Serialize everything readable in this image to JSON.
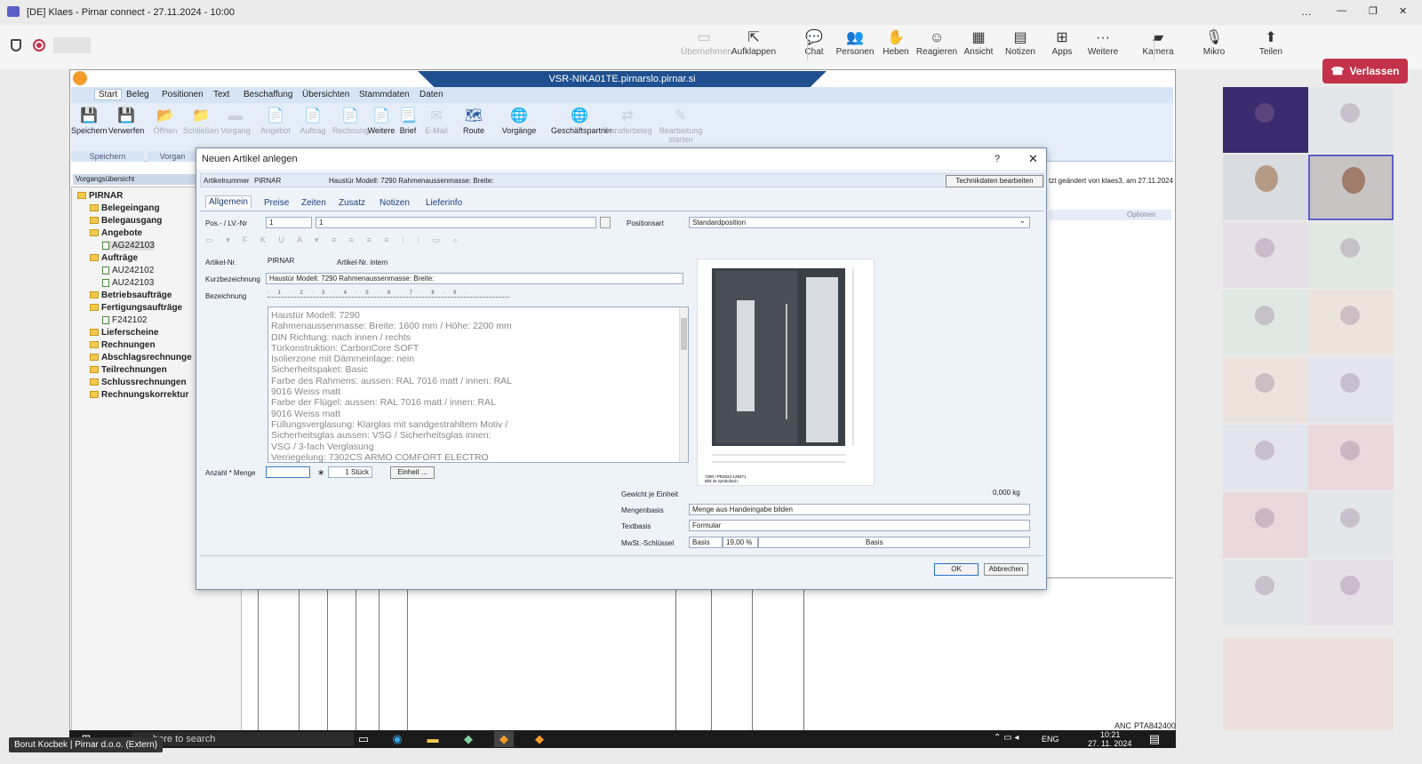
{
  "window": {
    "title": "[DE] Klaes - Pirnar connect - 27.11.2024 - 10:00",
    "controls": [
      "…",
      "—",
      "❐",
      "✕"
    ]
  },
  "meeting_toolbar": {
    "items": [
      {
        "label": "Übernehmen",
        "icon": "take-control-icon",
        "glyph": "▭",
        "disabled": true
      },
      {
        "label": "Aufklappen",
        "icon": "pop-out-icon",
        "glyph": "⇱",
        "disabled": false
      },
      {
        "label": "Chat",
        "icon": "chat-icon",
        "glyph": "💬",
        "disabled": false
      },
      {
        "label": "Personen",
        "icon": "people-icon",
        "glyph": "👥",
        "disabled": false
      },
      {
        "label": "Heben",
        "icon": "raise-hand-icon",
        "glyph": "✋",
        "disabled": false
      },
      {
        "label": "Reagieren",
        "icon": "react-icon",
        "glyph": "☺",
        "disabled": false
      },
      {
        "label": "Ansicht",
        "icon": "view-icon",
        "glyph": "▦",
        "disabled": false
      },
      {
        "label": "Notizen",
        "icon": "notes-icon",
        "glyph": "▤",
        "disabled": false
      },
      {
        "label": "Apps",
        "icon": "apps-icon",
        "glyph": "⊞",
        "disabled": false
      },
      {
        "label": "Weitere",
        "icon": "more-icon",
        "glyph": "···",
        "disabled": false
      },
      {
        "label": "Kamera",
        "icon": "camera-off-icon",
        "glyph": "▰",
        "disabled": false
      },
      {
        "label": "Mikro",
        "icon": "mic-off-icon",
        "glyph": "🎙",
        "disabled": false
      },
      {
        "label": "Teilen",
        "icon": "share-icon",
        "glyph": "⬆",
        "disabled": false
      }
    ],
    "leave_label": "Verlassen"
  },
  "remote": {
    "session_title": "VSR-NIKA01TE.pirnarslo.pirnar.si",
    "ribbon_tabs": [
      "Start",
      "Beleg",
      "Positionen",
      "Text",
      "Beschaffung",
      "Übersichten",
      "Stammdaten",
      "Daten"
    ],
    "ribbon_buttons": [
      {
        "label": "Speichern",
        "icon": "save-icon",
        "glyph": "💾",
        "disabled": false
      },
      {
        "label": "Verwerfen",
        "icon": "discard-icon",
        "glyph": "💾",
        "disabled": false
      },
      {
        "label": "Öffnen",
        "icon": "open-folder-icon",
        "glyph": "📂",
        "disabled": true
      },
      {
        "label": "Schließen",
        "icon": "close-folder-icon",
        "glyph": "📁",
        "disabled": true
      },
      {
        "label": "Vorgang",
        "icon": "process-icon",
        "glyph": "▬",
        "disabled": true
      },
      {
        "label": "Angebot",
        "icon": "offer-icon",
        "glyph": "📄",
        "disabled": true
      },
      {
        "label": "Auftrag",
        "icon": "order-icon",
        "glyph": "📄",
        "disabled": true
      },
      {
        "label": "Rechnung",
        "icon": "invoice-icon",
        "glyph": "📄",
        "disabled": true
      },
      {
        "label": "Weitere",
        "icon": "more-docs-icon",
        "glyph": "📄",
        "disabled": false
      },
      {
        "label": "Brief",
        "icon": "letter-icon",
        "glyph": "📃",
        "disabled": false
      },
      {
        "label": "E-Mail",
        "icon": "email-icon",
        "glyph": "✉",
        "disabled": true
      },
      {
        "label": "Route",
        "icon": "route-icon",
        "glyph": "🗺",
        "disabled": false
      },
      {
        "label": "Vorgänge",
        "icon": "processes-icon",
        "glyph": "🌐",
        "disabled": false
      },
      {
        "label": "Geschäftspartner",
        "icon": "partner-icon",
        "glyph": "🌐",
        "disabled": false
      },
      {
        "label": "Transferbeleg",
        "icon": "transfer-icon",
        "glyph": "⇄",
        "disabled": true
      },
      {
        "label": "Bearbeitung starten",
        "icon": "start-edit-icon",
        "glyph": "✎",
        "disabled": true
      }
    ],
    "ribbon_groups": [
      "Speichern",
      "Vorgan"
    ],
    "left_pane_title": "Vorgangsübersicht",
    "tree": [
      {
        "label": "PIRNAR",
        "level": 0,
        "kind": "folder",
        "bold": true
      },
      {
        "label": "Belegeingang",
        "level": 1,
        "kind": "folder",
        "bold": true
      },
      {
        "label": "Belegausgang",
        "level": 1,
        "kind": "folder",
        "bold": true
      },
      {
        "label": "Angebote",
        "level": 1,
        "kind": "folder",
        "bold": true
      },
      {
        "label": "AG242103",
        "level": 2,
        "kind": "doc",
        "bold": false
      },
      {
        "label": "Aufträge",
        "level": 1,
        "kind": "folder",
        "bold": true
      },
      {
        "label": "AU242102",
        "level": 2,
        "kind": "doc",
        "bold": false
      },
      {
        "label": "AU242103",
        "level": 2,
        "kind": "doc",
        "bold": false
      },
      {
        "label": "Betriebsaufträge",
        "level": 1,
        "kind": "folder",
        "bold": true
      },
      {
        "label": "Fertigungsaufträge",
        "level": 1,
        "kind": "folder",
        "bold": true
      },
      {
        "label": "F242102",
        "level": 2,
        "kind": "doc",
        "bold": false
      },
      {
        "label": "Lieferscheine",
        "level": 1,
        "kind": "folder",
        "bold": true
      },
      {
        "label": "Rechnungen",
        "level": 1,
        "kind": "folder",
        "bold": true
      },
      {
        "label": "Abschlagsrechnunge",
        "level": 1,
        "kind": "folder",
        "bold": true
      },
      {
        "label": "Teilrechnungen",
        "level": 1,
        "kind": "folder",
        "bold": true
      },
      {
        "label": "Schlussrechnungen",
        "level": 1,
        "kind": "folder",
        "bold": true
      },
      {
        "label": "Rechnungskorrektur",
        "level": 1,
        "kind": "folder",
        "bold": true
      }
    ],
    "last_changed": "tzt geändert von klaes3, am 27.11.2024",
    "options_label": "Optionen",
    "status_right": "PTA842400",
    "status_lang": "ANC"
  },
  "dialog": {
    "title": "Neuen Artikel anlegen",
    "help": "?",
    "close": "✕",
    "header": {
      "artikelnummer_label": "Artikelnummer",
      "artikelnummer_value": "PIRNAR",
      "summary": "Haustür Modell: 7290   Rahmenaussenmasse: Breite:",
      "tech_button": "Technikdaten bearbeiten"
    },
    "tabs": [
      "Allgemein",
      "Preise",
      "Zeiten",
      "Zusatz",
      "Notizen",
      "Lieferinfo"
    ],
    "pos_label": "Pos.- / LV.-Nr",
    "pos_value1": "1",
    "pos_value2": "1",
    "positionsart_label": "Positionsart",
    "positionsart_value": "Standardposition",
    "artikel_nr_label": "Artikel-Nr.",
    "artikel_nr_value": "PIRNAR",
    "artikel_intern_label": "Artikel-Nr. intern",
    "kurz_label": "Kurzbezeichnung",
    "kurz_value": "Haustür Modell: 7290  Rahmenaussenmasse: Breite:",
    "bez_label": "Bezeichnung",
    "description_lines": [
      "Haustür Modell: 7290",
      "Rahmenaussenmasse: Breite: 1600 mm / Höhe: 2200 mm",
      "DIN Richtung: nach innen / rechts",
      "Türkonstruktion: CarbonCore SOFT",
      "Isolierzone mit Dämmeinlage: nein",
      "Sicherheitspaket: Basic",
      "Farbe des Rahmens: aussen: RAL 7016 matt / innen: RAL",
      "9016 Weiss matt",
      "Farbe der Flügel: aussen: RAL 7016 matt / innen: RAL",
      "9016 Weiss matt",
      "Füllungsverglasung: Klarglas mit sandgestrahltem Motiv /",
      "Sicherheitsglas aussen: VSG / Sicherheitsglas innen:",
      "VSG / 3-fach Verglasung",
      "Verriegelung: 7302CS ARMO COMFORT ELECTRO"
    ],
    "anzahl_label": "Anzahl * Menge",
    "anzahl_value": "",
    "multiply": "∗",
    "menge_value": "1 Stück",
    "einheit_button": "Einheit ...",
    "gewicht_label": "Gewicht je Einheit",
    "gewicht_value": "0,000 kg",
    "mengenbasis_label": "Mengenbasis",
    "mengenbasis_value": "Menge aus Handeingabe bilden",
    "textbasis_label": "Textbasis",
    "textbasis_value": "Formular",
    "mwst_label": "MwSt.-Schlüssel",
    "mwst_value1": "Basis",
    "mwst_value2": "19,00 %",
    "mwst_value3": "Basis",
    "ok_label": "OK",
    "cancel_label": "Abbrechen",
    "preview_caption1": "7290 / PR2024-129371",
    "preview_caption2": "Bild ist symbolisch."
  },
  "taskbar": {
    "search_placeholder": "here to search",
    "lang": "ENG",
    "time": "10:21",
    "date": "27. 11. 2024"
  },
  "participant_caption": "Borut Kocbek | Pirnar d.o.o. (Extern)",
  "colors": {
    "leave": "#c4314b",
    "ribbon": "#e4edf8",
    "title_blue": "#1f4f8f"
  }
}
